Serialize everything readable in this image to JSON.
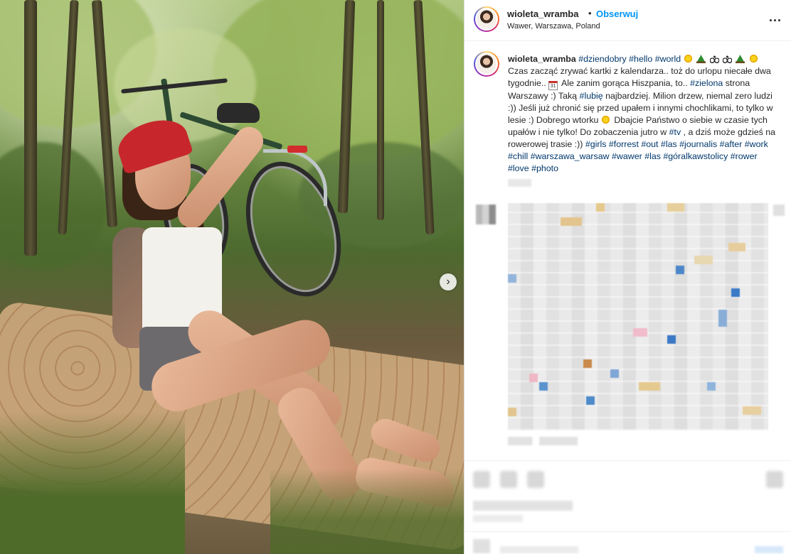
{
  "header": {
    "username": "wioleta_wramba",
    "separator": "•",
    "follow_label": "Obserwuj",
    "location": "Wawer, Warszawa, Poland",
    "more_label": "..."
  },
  "photo": {
    "alt": "Woman in red cap sitting on a yoga mat in a forest next to a bicycle",
    "next_label": "›"
  },
  "caption": {
    "username": "wioleta_wramba",
    "parts": [
      {
        "t": "tag",
        "v": "#dziendobry"
      },
      {
        "t": "tag",
        "v": "#hello"
      },
      {
        "t": "tag",
        "v": "#world"
      },
      {
        "t": "emoji",
        "v": "sun"
      },
      {
        "t": "emoji",
        "v": "tree"
      },
      {
        "t": "emoji",
        "v": "bike"
      },
      {
        "t": "emoji",
        "v": "bike"
      },
      {
        "t": "emoji",
        "v": "tree"
      },
      {
        "t": "emoji",
        "v": "sun"
      },
      {
        "t": "text",
        "v": "Czas zacząć zrywać kartki z kalendarza.. toż do urlopu niecałe dwa tygodnie.."
      },
      {
        "t": "emoji",
        "v": "cal",
        "label": "31"
      },
      {
        "t": "text",
        "v": "Ale zanim gorąca Hiszpania, to.."
      },
      {
        "t": "tag",
        "v": "#zielona"
      },
      {
        "t": "text",
        "v": "strona Warszawy :) Taką"
      },
      {
        "t": "tag",
        "v": "#lubię"
      },
      {
        "t": "text",
        "v": "najbardziej. Milion drzew, niemal zero ludzi :)) Jeśli już chronić się przed upałem i innymi chochlikami, to tylko w lesie :) Dobrego wtorku"
      },
      {
        "t": "emoji",
        "v": "sun"
      },
      {
        "t": "text",
        "v": "Dbajcie Państwo o siebie w czasie tych upałów i nie tylko! Do zobaczenia jutro w"
      },
      {
        "t": "tag",
        "v": "#tv"
      },
      {
        "t": "text",
        "v": ", a dziś może gdzieś na rowerowej trasie :))"
      },
      {
        "t": "tag",
        "v": "#girls"
      },
      {
        "t": "tag",
        "v": "#forrest"
      },
      {
        "t": "tag",
        "v": "#out"
      },
      {
        "t": "tag",
        "v": "#las"
      },
      {
        "t": "tag",
        "v": "#journalis"
      },
      {
        "t": "tag",
        "v": "#after"
      },
      {
        "t": "tag",
        "v": "#work"
      },
      {
        "t": "tag",
        "v": "#chill"
      },
      {
        "t": "tag",
        "v": "#warszawa_warsaw"
      },
      {
        "t": "tag",
        "v": "#wawer"
      },
      {
        "t": "tag",
        "v": "#las"
      },
      {
        "t": "tag",
        "v": "#góralkawstolicy"
      },
      {
        "t": "tag",
        "v": "#rower"
      },
      {
        "t": "tag",
        "v": "#love"
      },
      {
        "t": "tag",
        "v": "#photo"
      }
    ]
  },
  "colors": {
    "link_blue": "#0095f6",
    "hashtag": "#00376b",
    "text": "#262626",
    "border": "#dbdbdb"
  }
}
